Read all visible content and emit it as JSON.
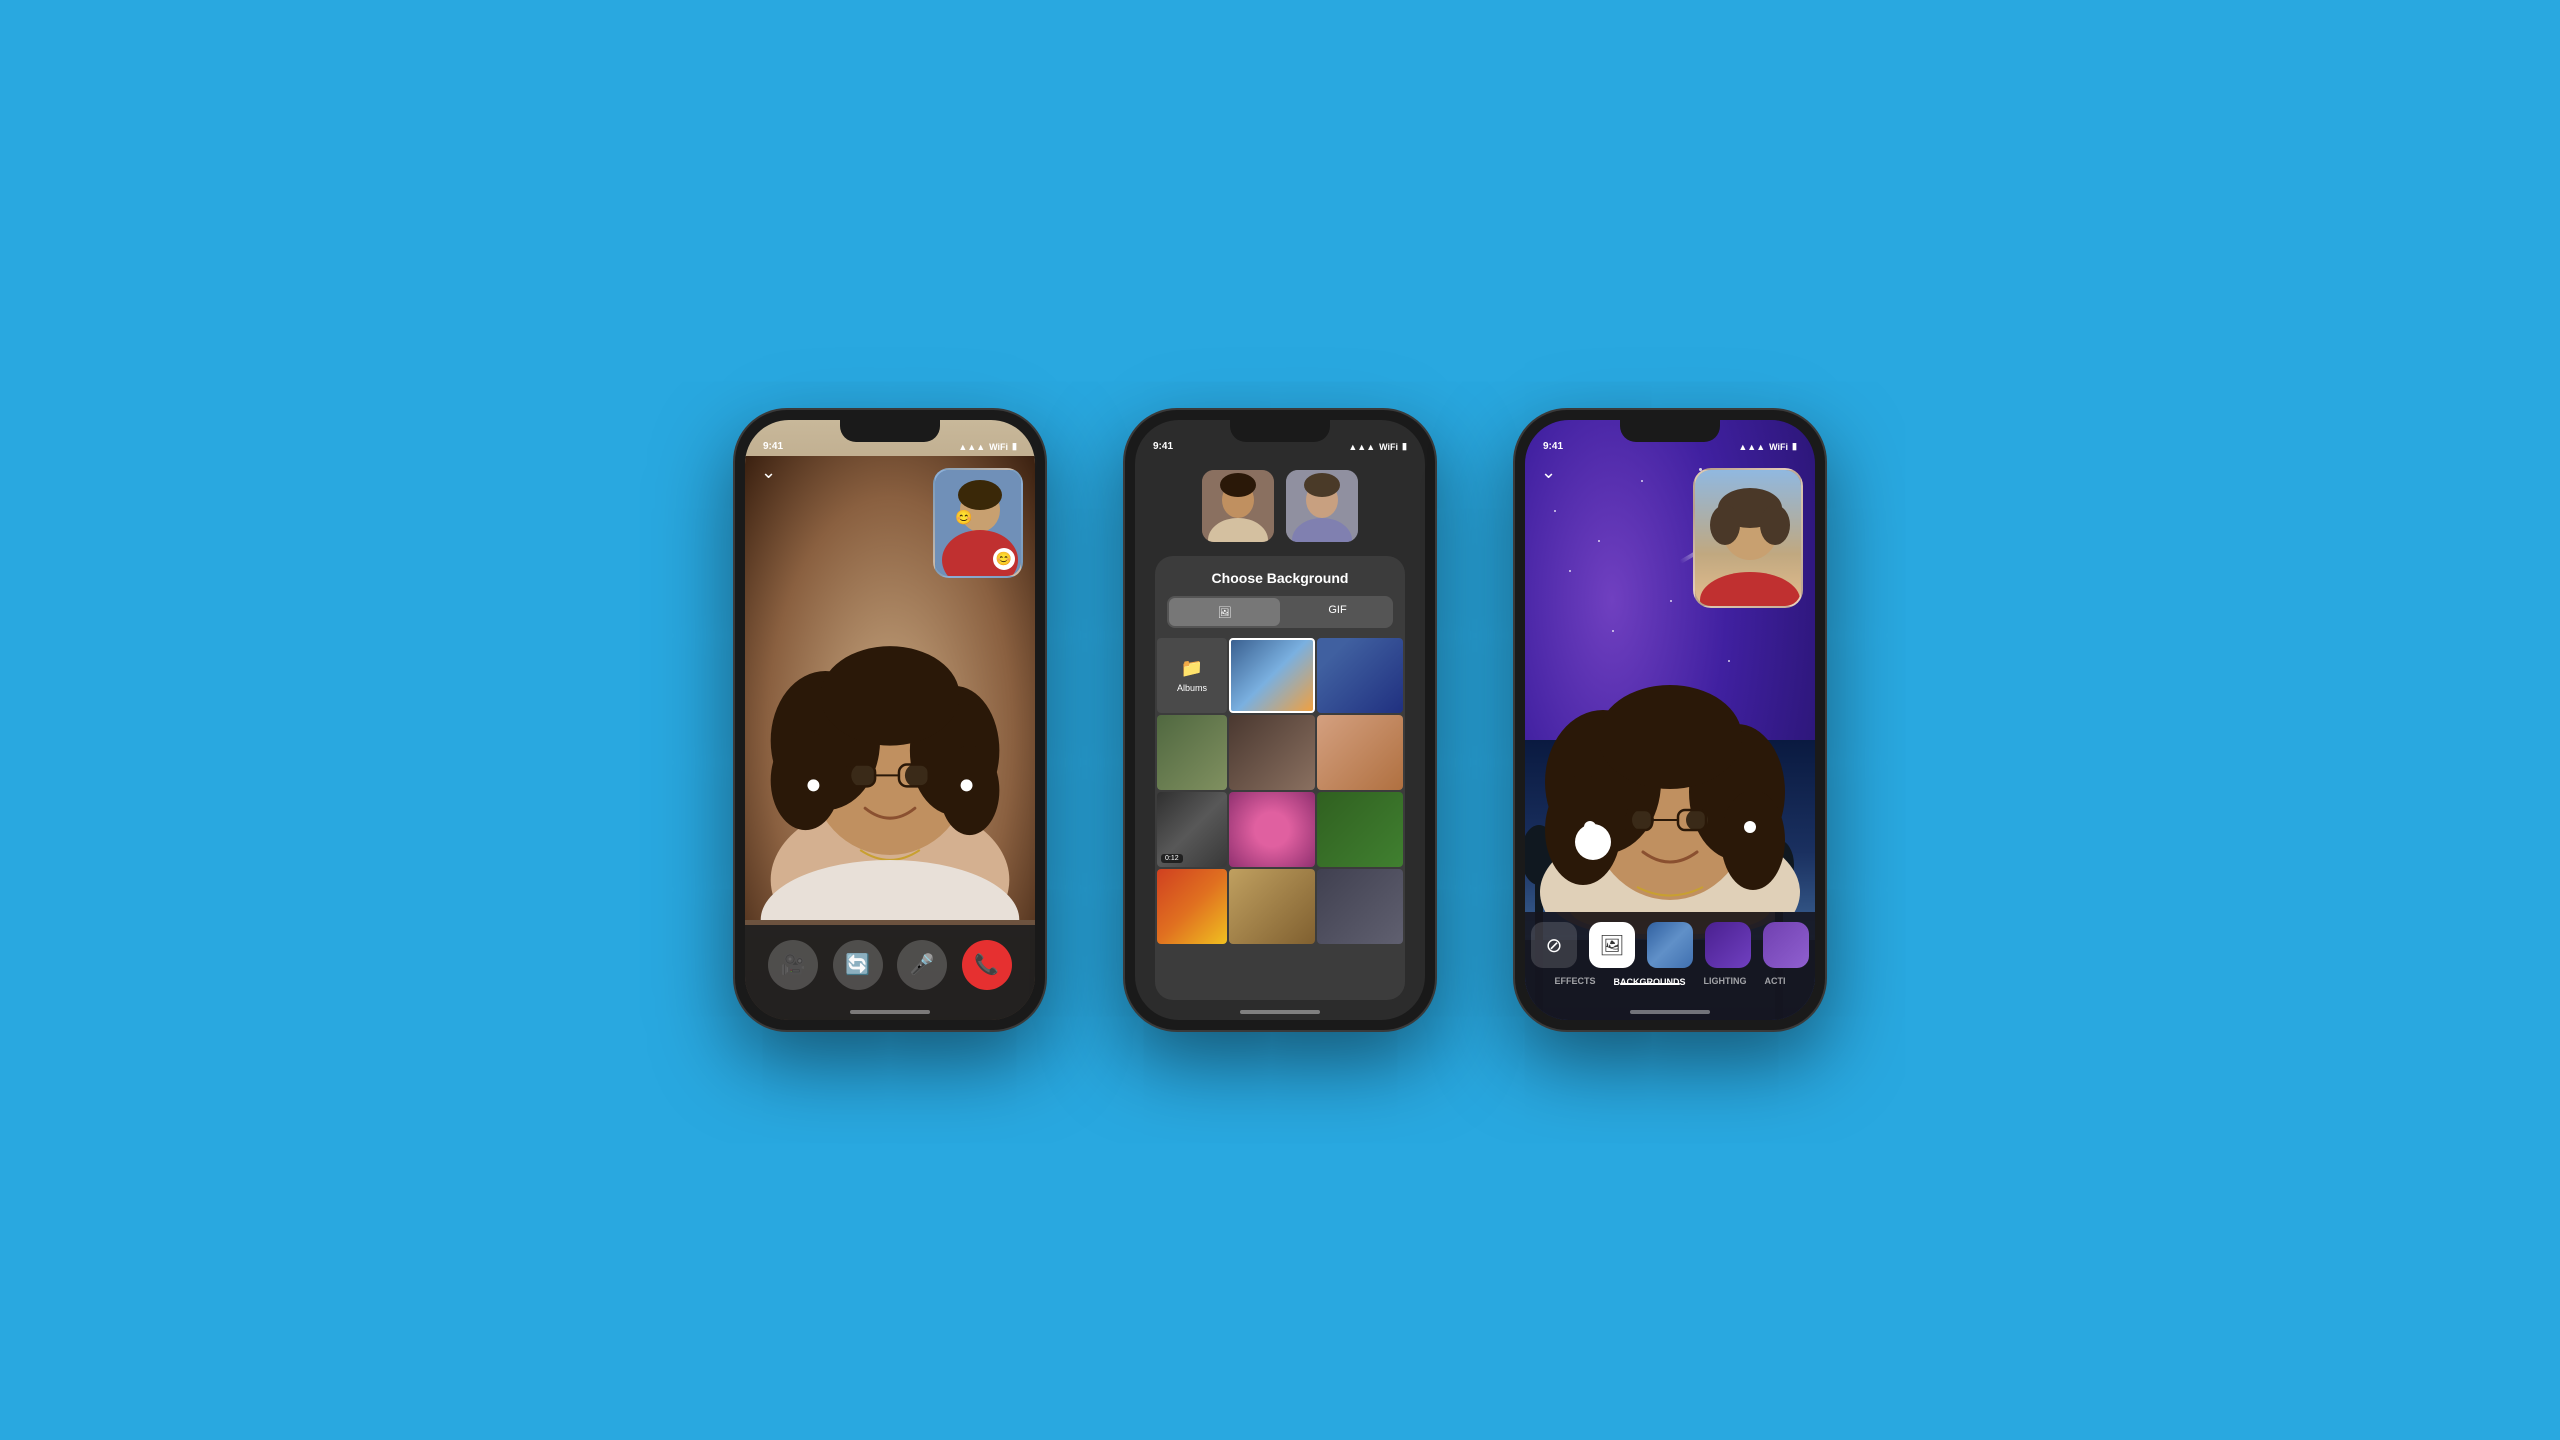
{
  "background_color": "#29A8E0",
  "phone1": {
    "status_time": "9:41",
    "status_signal": "▲▲▲",
    "status_wifi": "wifi",
    "status_battery": "battery",
    "chevron": "⌄",
    "smiley": "😊",
    "controls": [
      {
        "icon": "📷",
        "label": "camera",
        "type": "normal"
      },
      {
        "icon": "🔄",
        "label": "flip",
        "type": "normal"
      },
      {
        "icon": "🎤",
        "label": "mic",
        "type": "normal"
      },
      {
        "icon": "📞",
        "label": "end-call",
        "type": "red"
      }
    ]
  },
  "phone2": {
    "status_time": "9:41",
    "title": "Choose Background",
    "tab_photo_label": "🖼",
    "tab_gif_label": "GIF",
    "albums_label": "Albums",
    "grid_duration": "0:12",
    "grid_cells": [
      "sky-sunset",
      "dark-scene",
      "green-lawn",
      "coffee-food",
      "cinnamon-rolls",
      "dark-plaid",
      "pink-flower",
      "tropical-leaf",
      "fruits",
      "dog",
      "craft-flowers"
    ]
  },
  "phone3": {
    "status_time": "9:41",
    "chevron": "⌄",
    "effects_label": "EFFECTS",
    "backgrounds_label": "BACKGROUNDS",
    "lighting_label": "LIGHTING",
    "activity_label": "ACTI",
    "fx_buttons": [
      {
        "icon": "⊘",
        "label": "none",
        "active": false
      },
      {
        "icon": "🖼",
        "label": "backgrounds",
        "active": true
      },
      {
        "icon": "scene1",
        "active": false
      },
      {
        "icon": "purple",
        "active": false
      },
      {
        "icon": "violet",
        "active": false
      }
    ]
  }
}
